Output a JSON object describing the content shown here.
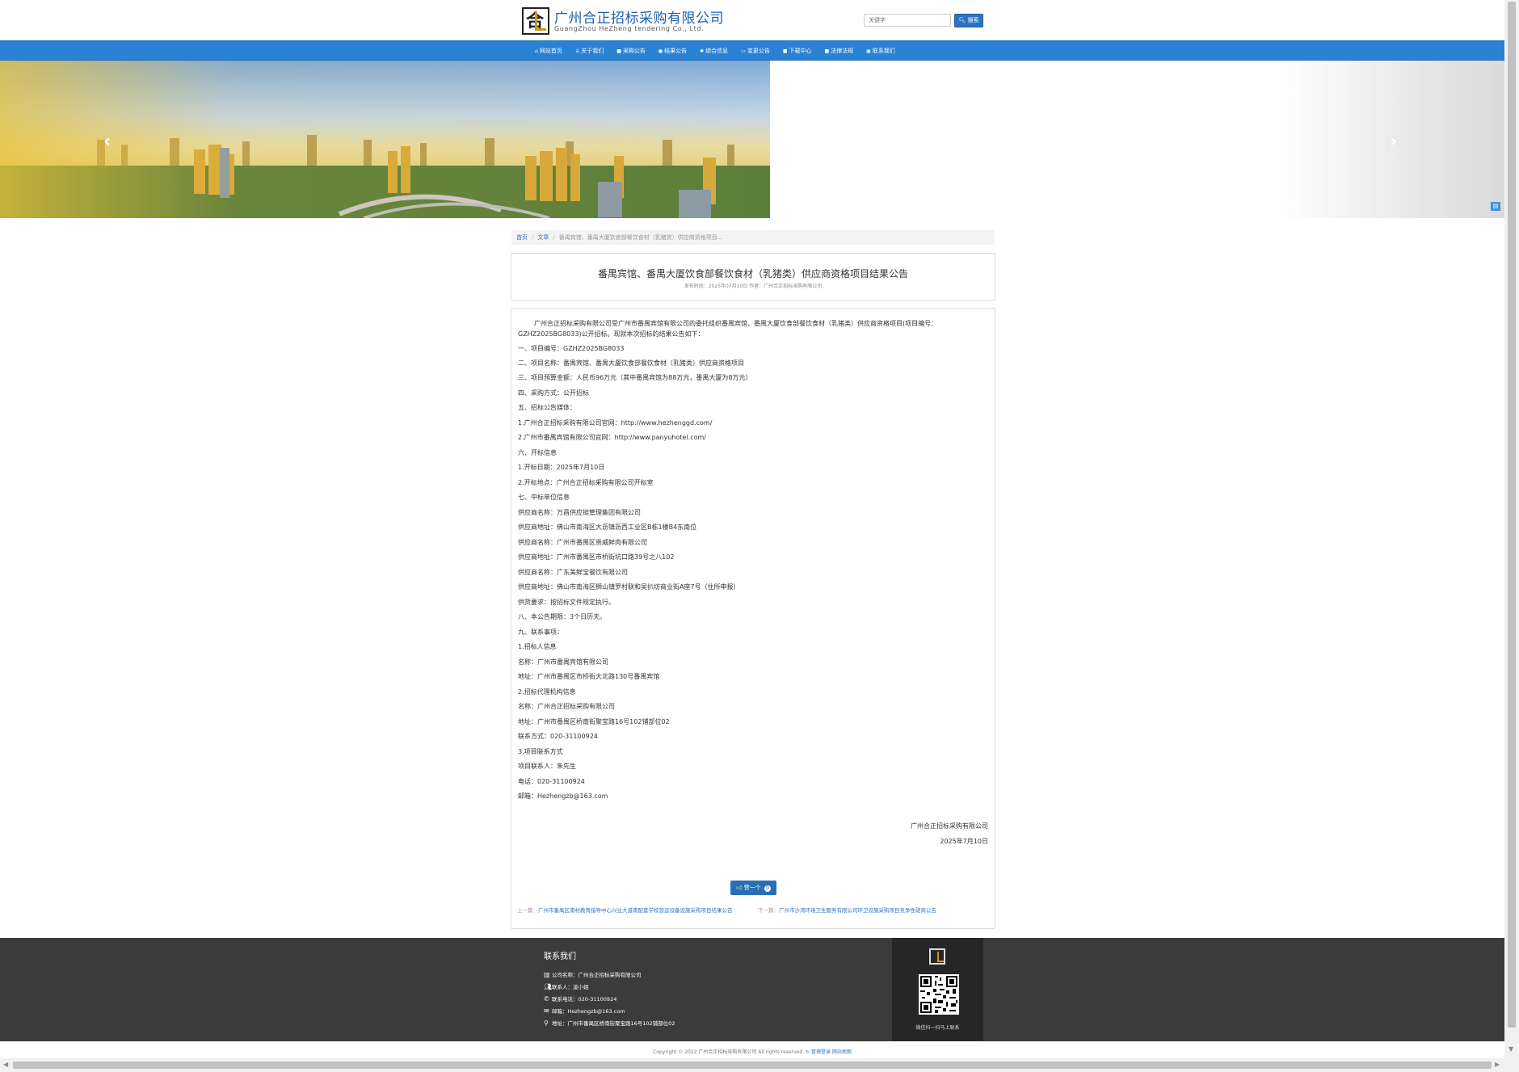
{
  "header": {
    "company_cn": "广州合正招标采购有限公司",
    "company_en": "GuangZhou HeZheng tendering  Co., Ltd.",
    "search_placeholder": "关键字",
    "search_button": "搜索"
  },
  "nav": {
    "items": [
      {
        "label": "网站首页"
      },
      {
        "label": "关于我们"
      },
      {
        "label": "采购公告"
      },
      {
        "label": "结果公告"
      },
      {
        "label": "综合信息"
      },
      {
        "label": "变更公告"
      },
      {
        "label": "下载中心"
      },
      {
        "label": "法律法规"
      },
      {
        "label": "联系我们"
      }
    ]
  },
  "banner": {
    "prev_icon": "chevron-left-icon",
    "next_icon": "chevron-right-icon"
  },
  "breadcrumb": {
    "home": "首页",
    "section": "文章",
    "current": "番禺宾馆、番禺大厦饮食部餐饮食材（乳猪类）供应商资格项目..."
  },
  "article": {
    "title": "番禺宾馆、番禺大厦饮食部餐饮食材（乳猪类）供应商资格项目结果公告",
    "meta": "发布时间：2025年07月10日 作者：广州合正招标采购有限公司",
    "intro": "广州合正招标采购有限公司受广州市番禺宾馆有限公司的委托组织番禺宾馆、番禺大厦饮食部餐饮食材（乳猪类）供应商资格项目(项目编号：GZHZ2025BG8033)公开招标。现就本次招标的结果公告如下：",
    "lines": [
      "一、项目编号：GZHZ2025BG8033",
      "二、项目名称：番禺宾馆、番禺大厦饮食部餐饮食材（乳猪类）供应商资格项目",
      "三、项目预算金额：人民币96万元（其中番禺宾馆为88万元，番禺大厦为8万元）",
      "四、采购方式：公开招标",
      "五、招标公告媒体：",
      "1.广州合正招标采购有限公司官网：http://www.hezhenggd.com/",
      "2.广州市番禺宾馆有限公司官网：http://www.panyuhotel.com/",
      "六、开标信息",
      "1.开标日期：2025年7月10日",
      "2.开标地点：广州合正招标采购有限公司开标室",
      "七、中标单位信息",
      "供应商名称：万昌供应链管理集团有限公司",
      "供应商地址：佛山市南海区大沥镇沥西工业区B栋1楼B4东南位",
      "供应商名称：广州市番禺区贵威鲜肉有限公司",
      "供应商地址：广州市番禺区市桥街坑口路39号之八102",
      "供应商名称：广东美鲜宝餐饮有限公司",
      "供应商地址：佛山市南海区狮山镇罗村联和吴扒坊商业街A座7号（住所申报）",
      "供货要求：按招标文件规定执行。",
      "八、本公告期限：3个日历天。",
      "九、联系事项：",
      "1.招标人信息",
      "名称：广州市番禺宾馆有限公司",
      "地址：广州市番禺区市桥街大北路130号番禺宾馆",
      "2.招标代理机构信息",
      "名称：广州合正招标采购有限公司",
      "地址：广州市番禺区桥南街聚宝路16号102铺部位02",
      "联系方式：020-31100924",
      "3.项目联系方式",
      "项目联系人：朱先生",
      "电话：020-31100924",
      "邮箱：Hezhengzb@163.com"
    ],
    "sign_company": "广州合正招标采购有限公司",
    "sign_date": "2025年7月10日",
    "like_label": "赞一个",
    "like_count": "0",
    "prev_label": "上一篇：",
    "prev_title": "广州市番禺区南村教育指导中心兴业大道南配套学校营运设备设施采购项目结果公告",
    "next_label": "下一篇：",
    "next_title": "广州市沙湾环境卫生服务有限公司环卫设施采购项目竞争性磋商公告"
  },
  "footer": {
    "title": "联系我们",
    "company": "公司名称：广州合正招标采购有限公司",
    "contact": "联系人：凌小姐",
    "phone": "联系电话：020-31100924",
    "email": "邮箱：Hezhengzb@163.com",
    "address": "地址：广州市番禺区桥南街聚宝路16号102铺部位02",
    "qr_caption": "微信扫一扫马上联系"
  },
  "copyright": {
    "text": "Copyright © 2022 广州合正招标采购有限公司 All rights reserved.",
    "admin_link": "管理登录",
    "sitemap_link": "网站地图"
  },
  "colors": {
    "nav": "#2a82d4",
    "brand": "#1a5fb4",
    "footer": "#3b3b3b"
  }
}
